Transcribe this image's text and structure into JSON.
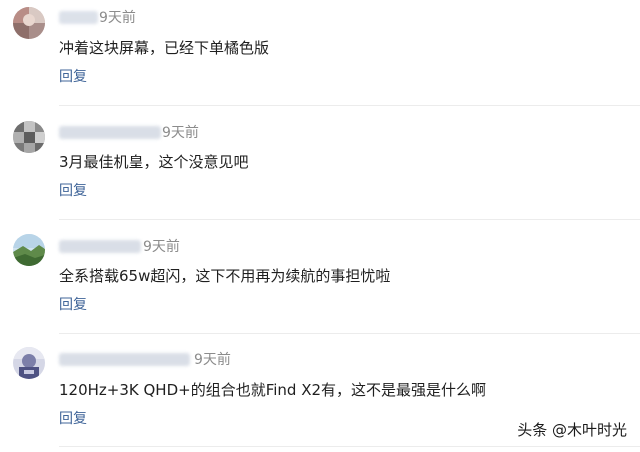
{
  "comments": [
    {
      "time": "9天前",
      "text": "冲着这块屏幕，已经下单橘色版",
      "reply_label": "回复"
    },
    {
      "time": "9天前",
      "text": "3月最佳机皇，这个没意见吧",
      "reply_label": "回复"
    },
    {
      "time": "9天前",
      "text": "全系搭载65w超闪，这下不用再为续航的事担忧啦",
      "reply_label": "回复"
    },
    {
      "time": "9天前",
      "text": "120Hz+3K QHD+的组合也就Find X2有，这不是最强是什么啊",
      "reply_label": "回复"
    }
  ],
  "watermark": "头条 @木叶时光",
  "colors": {
    "reply_link": "#406599",
    "timestamp": "#8c8c8c",
    "divider": "#ececec"
  }
}
